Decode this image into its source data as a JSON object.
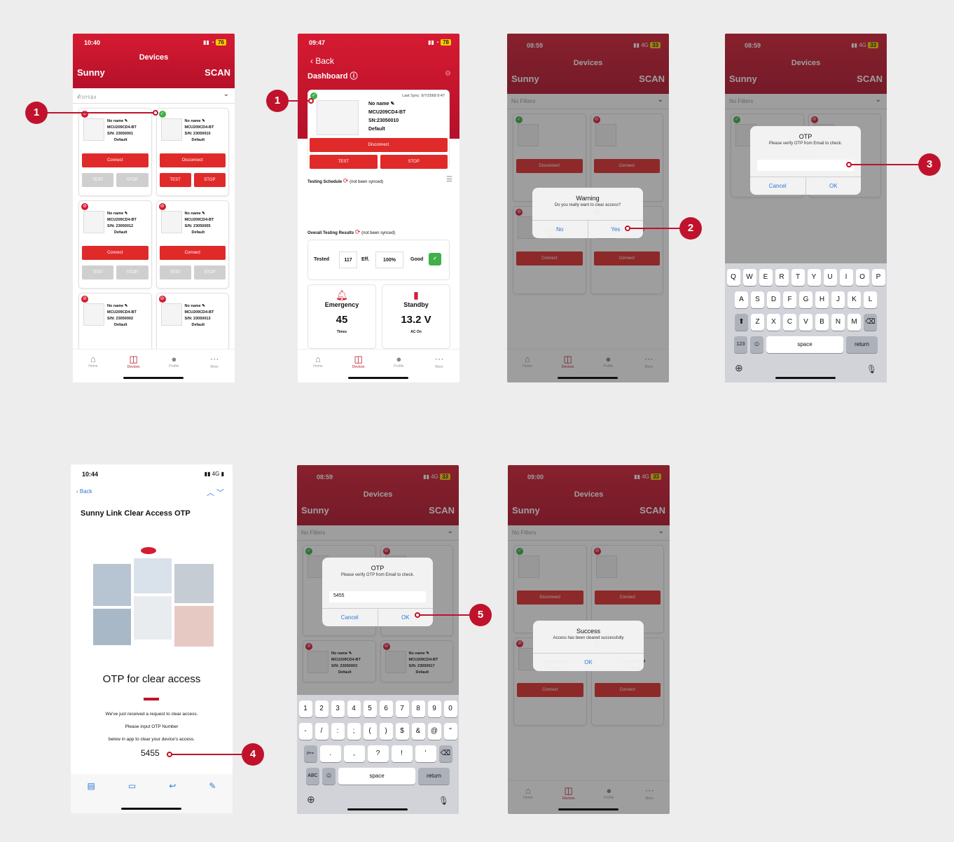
{
  "screen1": {
    "time": "10:40",
    "battery": "76",
    "title": "Devices",
    "left": "Sunny",
    "right": "SCAN",
    "filter": "ตัวกรอง",
    "cards": [
      {
        "name": "No name",
        "model": "MCU209CD4-BT",
        "sn": "S/N: 23050001",
        "default": "Default",
        "action": "Connect",
        "test": "TEST",
        "stop": "STOP",
        "connected": false
      },
      {
        "name": "No name",
        "model": "MCU209CD4-BT",
        "sn": "S/N: 23050010",
        "default": "Default",
        "action": "Disconnect",
        "test": "TEST",
        "stop": "STOP",
        "connected": true
      },
      {
        "name": "No name",
        "model": "MCU209CD4-BT",
        "sn": "S/N: 23050012",
        "default": "Default",
        "action": "Connect",
        "test": "TEST",
        "stop": "STOP",
        "connected": false
      },
      {
        "name": "No name",
        "model": "MCU209CD4-BT",
        "sn": "S/N: 23050005",
        "default": "Default",
        "action": "Connect",
        "test": "TEST",
        "stop": "STOP",
        "connected": false
      },
      {
        "name": "No name",
        "model": "MCU209CD4-BT",
        "sn": "S/N: 23050002",
        "default": "Default",
        "connected": false
      },
      {
        "name": "No name",
        "model": "MCU209CD4-BT",
        "sn": "S/N: 23050013",
        "default": "Default",
        "connected": false
      }
    ]
  },
  "tabs": [
    "Home",
    "Devices",
    "Profile",
    "More"
  ],
  "screen2": {
    "time": "09:47",
    "back": "Back",
    "title": "Dashboard",
    "last_sync": "Last Sync: 9/7/2568 9:47",
    "name": "No name",
    "model": "MCU209CD4-BT",
    "sn": "SN:23050010",
    "default": "Default",
    "disconnect": "Disconnect",
    "test": "TEST",
    "stop": "STOP",
    "schedule": "Testing Schedule",
    "not_synced": "(not been synced)",
    "overall": "Overall Testing Results",
    "tested_label": "Tested",
    "tested_value": "117",
    "eff_label": "Eff.",
    "eff_value": "100%",
    "good_label": "Good",
    "emergency_label": "Emergency",
    "emergency_value": "45",
    "emergency_unit": "Times",
    "standby_label": "Standby",
    "standby_value": "13.2 V",
    "standby_unit": "AC On"
  },
  "screen3": {
    "time": "08:59",
    "network": "4G",
    "battery": "33",
    "filter": "No Filters",
    "dialog_title": "Warning",
    "dialog_msg": "Do you really want to clear access?",
    "no": "No",
    "yes": "Yes",
    "sn3": "S/N: 23050003",
    "sn4": "S/N: 23050017",
    "disconnect": "Disconnect",
    "connect": "Connect",
    "default": "Default"
  },
  "screen4": {
    "dialog_title": "OTP",
    "dialog_msg": "Please verify OTP from Email to check.",
    "cancel": "Cancel",
    "ok": "OK",
    "row1": [
      "Q",
      "W",
      "E",
      "R",
      "T",
      "Y",
      "U",
      "I",
      "O",
      "P"
    ],
    "row2": [
      "A",
      "S",
      "D",
      "F",
      "G",
      "H",
      "J",
      "K",
      "L"
    ],
    "row3": [
      "Z",
      "X",
      "C",
      "V",
      "B",
      "N",
      "M"
    ],
    "num_key": "123",
    "space": "space",
    "return": "return"
  },
  "screen5": {
    "time": "10:44",
    "back": "Back",
    "subject": "Sunny Link Clear Access OTP",
    "heading": "OTP for clear access",
    "line1": "We've just received a request to clear access.",
    "line2": "Please input OTP Number",
    "line3": "below in app to clear your device's access.",
    "otp": "5455"
  },
  "screen6": {
    "input_value": "5455",
    "num_row1": [
      "1",
      "2",
      "3",
      "4",
      "5",
      "6",
      "7",
      "8",
      "9",
      "0"
    ],
    "num_row2": [
      "-",
      "/",
      ":",
      ";",
      "(",
      ")",
      "$",
      "&",
      "@",
      "\""
    ],
    "num_row3": [
      ".",
      ",",
      "?",
      "!",
      "'"
    ],
    "sym_key": "#+=",
    "abc_key": "ABC"
  },
  "screen7": {
    "time": "09:00",
    "dialog_title": "Success",
    "dialog_msg": "Access has been cleared successfully",
    "ok": "OK"
  },
  "badges": [
    "1",
    "1",
    "2",
    "3",
    "4",
    "5"
  ],
  "colors": {
    "brand": "#c0122c",
    "link": "#2a7ad8",
    "ok": "#3fb04a"
  }
}
